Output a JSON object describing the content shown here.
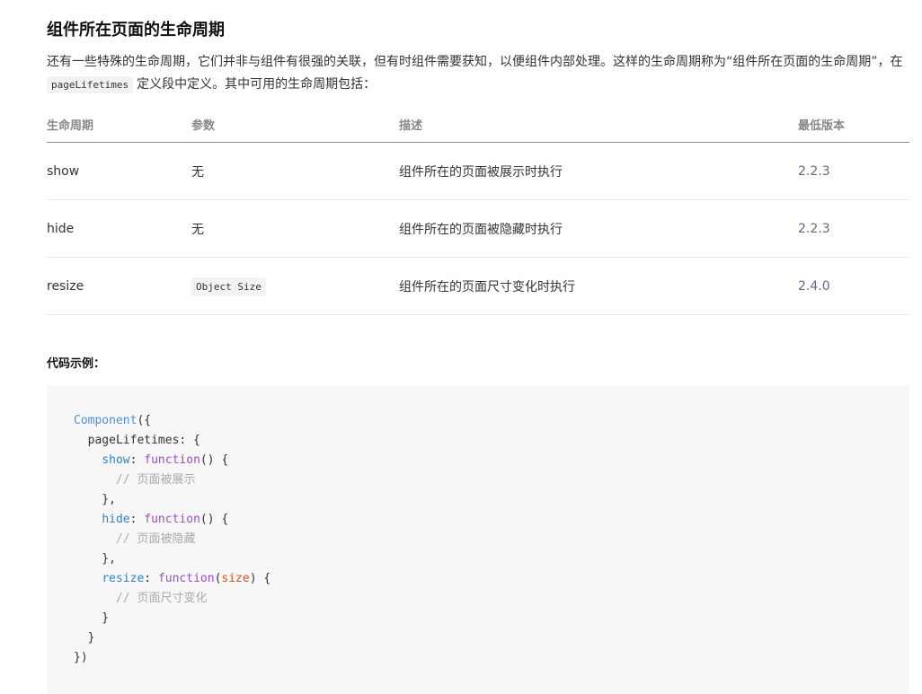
{
  "heading": "组件所在页面的生命周期",
  "intro": {
    "text1": "还有一些特殊的生命周期，它们并非与组件有很强的关联，但有时组件需要获知，以便组件内部处理。这样的生命周期称为“组件所在页面的生命周期”，在",
    "code": "pageLifetimes",
    "text2": "定义段中定义。其中可用的生命周期包括："
  },
  "table": {
    "headers": [
      "生命周期",
      "参数",
      "描述",
      "最低版本"
    ],
    "rows": [
      {
        "name": "show",
        "param": "无",
        "param_is_code": false,
        "desc": "组件所在的页面被展示时执行",
        "version": "2.2.3"
      },
      {
        "name": "hide",
        "param": "无",
        "param_is_code": false,
        "desc": "组件所在的页面被隐藏时执行",
        "version": "2.2.3"
      },
      {
        "name": "resize",
        "param": "Object Size",
        "param_is_code": true,
        "desc": "组件所在的页面尺寸变化时执行",
        "version": "2.4.0"
      }
    ]
  },
  "example_title": "代码示例：",
  "code": {
    "component": "Component",
    "pageLifetimes": "pageLifetimes",
    "show": "show",
    "hide": "hide",
    "resize": "resize",
    "function_kw": "function",
    "size_param": "size",
    "comment_show": "// 页面被展示",
    "comment_hide": "// 页面被隐藏",
    "comment_resize": "// 页面尺寸变化"
  },
  "colors": {
    "link_version": "#576b95",
    "code_bg": "#f7f7f7",
    "keyword_blue": "#4a90e2",
    "keyword_purple": "#9b4dca",
    "param_orange": "#d9531e"
  }
}
